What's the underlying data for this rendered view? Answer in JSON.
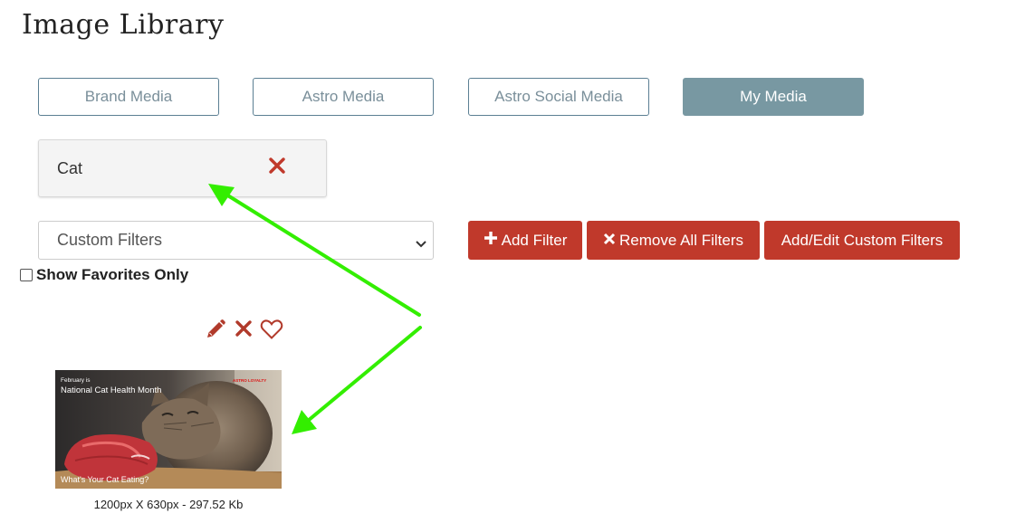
{
  "page": {
    "title": "Image Library"
  },
  "tabs": [
    {
      "label": "Brand Media",
      "active": false
    },
    {
      "label": "Astro Media",
      "active": false
    },
    {
      "label": "Astro Social Media",
      "active": false
    },
    {
      "label": "My Media",
      "active": true
    }
  ],
  "active_filter": {
    "label": "Cat",
    "remove_icon": "close-icon"
  },
  "filters": {
    "select_value": "Custom Filters",
    "add_filter_label": "Add Filter",
    "remove_all_label": "Remove All Filters",
    "edit_custom_label": "Add/Edit Custom Filters"
  },
  "favorites": {
    "label": "Show Favorites Only",
    "checked": false
  },
  "image_actions": {
    "icons": [
      "pencil-icon",
      "close-icon",
      "heart-icon"
    ]
  },
  "images": [
    {
      "thumb_top_small": "February is",
      "thumb_title": "National Cat Health Month",
      "thumb_bottom": "What's Your Cat Eating?",
      "thumb_logo": "ASTRO LOYALTY",
      "caption": "1200px X 630px - 297.52 Kb"
    }
  ],
  "colors": {
    "accent_red": "#c0392b",
    "tab_border": "#5b7f93",
    "tab_active_bg": "#7898a2",
    "annotation_arrow": "#33ee00"
  }
}
